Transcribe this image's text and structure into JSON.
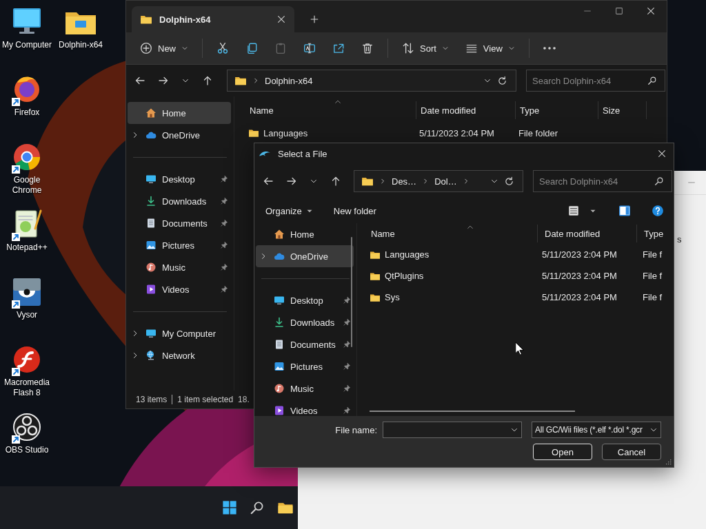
{
  "desktop_icons": [
    {
      "label": "My Computer",
      "kind": "computer"
    },
    {
      "label": "Dolphin-x64",
      "kind": "folder"
    },
    {
      "label": "Firefox",
      "kind": "firefox"
    },
    {
      "label": "Google Chrome",
      "kind": "chrome"
    },
    {
      "label": "Notepad++",
      "kind": "notepad"
    },
    {
      "label": "Vysor",
      "kind": "vysor"
    },
    {
      "label": "Macromedia Flash 8",
      "kind": "flash"
    },
    {
      "label": "OBS Studio",
      "kind": "obs"
    }
  ],
  "explorer": {
    "tab_title": "Dolphin-x64",
    "toolbar": [
      {
        "kind": "new",
        "label": "New",
        "disabled": false
      },
      {
        "kind": "cut",
        "disabled": false
      },
      {
        "kind": "copy",
        "disabled": false
      },
      {
        "kind": "paste",
        "disabled": true
      },
      {
        "kind": "rename",
        "disabled": false
      },
      {
        "kind": "share",
        "disabled": false
      },
      {
        "kind": "delete",
        "disabled": false
      },
      {
        "kind": "sort",
        "label": "Sort",
        "disabled": false
      },
      {
        "kind": "view",
        "label": "View",
        "disabled": false
      },
      {
        "kind": "more",
        "disabled": false
      }
    ],
    "address": [
      "Dolphin-x64"
    ],
    "search_placeholder": "Search Dolphin-x64",
    "nav_groups": [
      [
        {
          "label": "Home",
          "kind": "home",
          "selected": true,
          "pinned": false,
          "expandable": false
        },
        {
          "label": "OneDrive",
          "kind": "cloud",
          "selected": false,
          "pinned": false,
          "expandable": true
        }
      ],
      [
        {
          "label": "Desktop",
          "kind": "desktop",
          "selected": false,
          "pinned": true,
          "expandable": false
        },
        {
          "label": "Downloads",
          "kind": "download",
          "selected": false,
          "pinned": true,
          "expandable": false
        },
        {
          "label": "Documents",
          "kind": "document",
          "selected": false,
          "pinned": true,
          "expandable": false
        },
        {
          "label": "Pictures",
          "kind": "picture",
          "selected": false,
          "pinned": true,
          "expandable": false
        },
        {
          "label": "Music",
          "kind": "music",
          "selected": false,
          "pinned": true,
          "expandable": false
        },
        {
          "label": "Videos",
          "kind": "video",
          "selected": false,
          "pinned": true,
          "expandable": false
        }
      ],
      [
        {
          "label": "My Computer",
          "kind": "desktop",
          "selected": false,
          "pinned": false,
          "expandable": true
        },
        {
          "label": "Network",
          "kind": "network",
          "selected": false,
          "pinned": false,
          "expandable": true
        }
      ]
    ],
    "columns": [
      "Name",
      "Date modified",
      "Type",
      "Size"
    ],
    "rows": [
      {
        "name": "Languages",
        "date": "5/11/2023 2:04 PM",
        "type": "File folder"
      }
    ],
    "status": [
      "13 items",
      "1 item selected",
      "18."
    ]
  },
  "dialog": {
    "title": "Select a File",
    "address": [
      "Des…",
      "Dol…"
    ],
    "search_placeholder": "Search Dolphin-x64",
    "organize": "Organize",
    "new_folder": "New folder",
    "nav_groups": [
      [
        {
          "label": "Home",
          "kind": "home",
          "selected": false,
          "pinned": false,
          "expandable": false
        },
        {
          "label": "OneDrive",
          "kind": "cloud",
          "selected": true,
          "pinned": false,
          "expandable": true
        }
      ],
      [
        {
          "label": "Desktop",
          "kind": "desktop",
          "selected": false,
          "pinned": true,
          "expandable": false
        },
        {
          "label": "Downloads",
          "kind": "download",
          "selected": false,
          "pinned": true,
          "expandable": false
        },
        {
          "label": "Documents",
          "kind": "document",
          "selected": false,
          "pinned": true,
          "expandable": false
        },
        {
          "label": "Pictures",
          "kind": "picture",
          "selected": false,
          "pinned": true,
          "expandable": false
        },
        {
          "label": "Music",
          "kind": "music",
          "selected": false,
          "pinned": true,
          "expandable": false
        },
        {
          "label": "Videos",
          "kind": "video",
          "selected": false,
          "pinned": true,
          "expandable": false
        }
      ]
    ],
    "columns": [
      "Name",
      "Date modified",
      "Type"
    ],
    "rows": [
      {
        "name": "Languages",
        "date": "5/11/2023 2:04 PM",
        "type": "File f"
      },
      {
        "name": "QtPlugins",
        "date": "5/11/2023 2:04 PM",
        "type": "File f"
      },
      {
        "name": "Sys",
        "date": "5/11/2023 2:04 PM",
        "type": "File f"
      }
    ],
    "file_name_label": "File name:",
    "file_type": "All GC/Wii files (*.elf *.dol *.gcr",
    "buttons": [
      "Open",
      "Cancel"
    ]
  },
  "behind_window": {
    "text": "s"
  }
}
